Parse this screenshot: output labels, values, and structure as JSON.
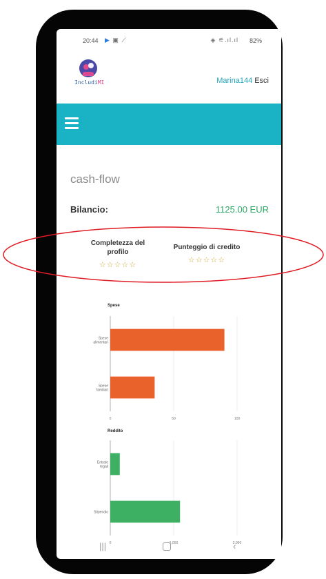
{
  "status_bar": {
    "time": "20:44",
    "battery": "82%"
  },
  "header": {
    "logo_text": "IncludiMI",
    "logo_text_main": "Includi",
    "logo_text_accent": "MI",
    "username": "Marina144",
    "logout_label": "Esci"
  },
  "colors": {
    "navbar": "#1ab3c6",
    "username": "#1fa5b8",
    "balance": "#2fa766",
    "expense_bar": "#e9622b",
    "income_bar": "#3eb064",
    "highlight": "#e01b24"
  },
  "page": {
    "title": "cash-flow",
    "balance_label": "Bilancio:",
    "balance_value": "1125.00 EUR"
  },
  "scores": {
    "completeness_label": "Completezza del profilo",
    "completeness_rating": 0,
    "credit_label": "Punteggio di credito",
    "credit_rating": 0,
    "max_rating": 5
  },
  "chart_data": [
    {
      "type": "bar",
      "orientation": "horizontal",
      "title": "Spese",
      "categories": [
        "Spese alimentari",
        "Spese familiari"
      ],
      "values": [
        90,
        35
      ],
      "xlim": [
        0,
        100
      ],
      "ticks": [
        "0",
        "50",
        "100"
      ],
      "color": "#e9622b"
    },
    {
      "type": "bar",
      "orientation": "horizontal",
      "title": "Reddito",
      "categories": [
        "Entrate regali",
        "Stipendio"
      ],
      "values": [
        150,
        1100
      ],
      "xlim": [
        0,
        2000
      ],
      "ticks": [
        "0",
        "1,000",
        "2,000"
      ],
      "color": "#3eb064"
    }
  ],
  "nav_bar": {
    "icons": [
      "recent-apps-icon",
      "home-icon",
      "back-icon"
    ]
  }
}
